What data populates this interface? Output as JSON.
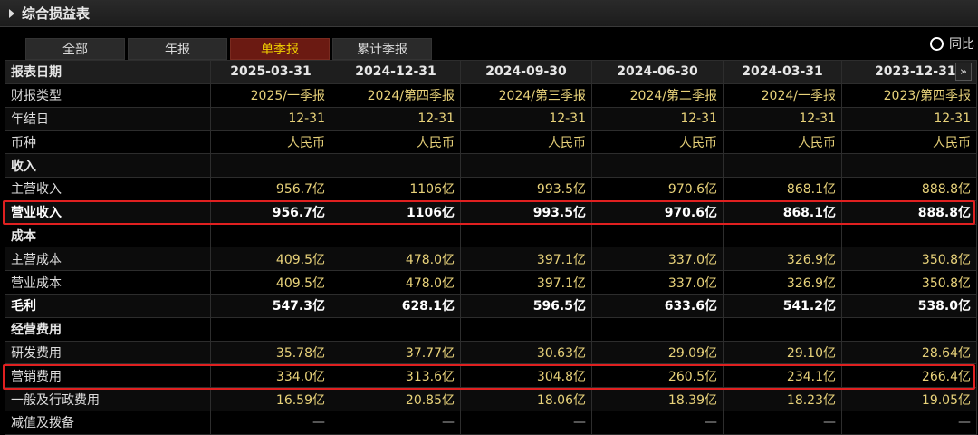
{
  "panel": {
    "title": "综合损益表"
  },
  "tabs": [
    {
      "label": "全部",
      "active": false
    },
    {
      "label": "年报",
      "active": false
    },
    {
      "label": "单季报",
      "active": true
    },
    {
      "label": "累计季报",
      "active": false
    }
  ],
  "yoy_label": "同比",
  "header": {
    "first": "报表日期",
    "dates": [
      "2025-03-31",
      "2024-12-31",
      "2024-09-30",
      "2024-06-30",
      "2024-03-31",
      "2023-12-31"
    ]
  },
  "rows": [
    {
      "label": "财报类型",
      "values": [
        "2025/一季报",
        "2024/第四季报",
        "2024/第三季报",
        "2024/第二季报",
        "2024/一季报",
        "2023/第四季报"
      ]
    },
    {
      "label": "年结日",
      "values": [
        "12-31",
        "12-31",
        "12-31",
        "12-31",
        "12-31",
        "12-31"
      ]
    },
    {
      "label": "币种",
      "values": [
        "人民币",
        "人民币",
        "人民币",
        "人民币",
        "人民币",
        "人民币"
      ]
    },
    {
      "label": "收入",
      "section": true
    },
    {
      "label": "主营收入",
      "values": [
        "956.7亿",
        "1106亿",
        "993.5亿",
        "970.6亿",
        "868.1亿",
        "888.8亿"
      ]
    },
    {
      "label": "营业收入",
      "bold": true,
      "values": [
        "956.7亿",
        "1106亿",
        "993.5亿",
        "970.6亿",
        "868.1亿",
        "888.8亿"
      ]
    },
    {
      "label": "成本",
      "section": true
    },
    {
      "label": "主营成本",
      "values": [
        "409.5亿",
        "478.0亿",
        "397.1亿",
        "337.0亿",
        "326.9亿",
        "350.8亿"
      ]
    },
    {
      "label": "营业成本",
      "values": [
        "409.5亿",
        "478.0亿",
        "397.1亿",
        "337.0亿",
        "326.9亿",
        "350.8亿"
      ]
    },
    {
      "label": "毛利",
      "bold": true,
      "values": [
        "547.3亿",
        "628.1亿",
        "596.5亿",
        "633.6亿",
        "541.2亿",
        "538.0亿"
      ]
    },
    {
      "label": "经营费用",
      "section": true
    },
    {
      "label": "研发费用",
      "values": [
        "35.78亿",
        "37.77亿",
        "30.63亿",
        "29.09亿",
        "29.10亿",
        "28.64亿"
      ]
    },
    {
      "label": "营销费用",
      "values": [
        "334.0亿",
        "313.6亿",
        "304.8亿",
        "260.5亿",
        "234.1亿",
        "266.4亿"
      ]
    },
    {
      "label": "一般及行政费用",
      "values": [
        "16.59亿",
        "20.85亿",
        "18.06亿",
        "18.39亿",
        "18.23亿",
        "19.05亿"
      ]
    },
    {
      "label": "减值及拨备",
      "values": [
        "—",
        "—",
        "—",
        "—",
        "—",
        "—"
      ]
    }
  ],
  "scroll_glyph": "»",
  "highlight_color": "#e02020"
}
